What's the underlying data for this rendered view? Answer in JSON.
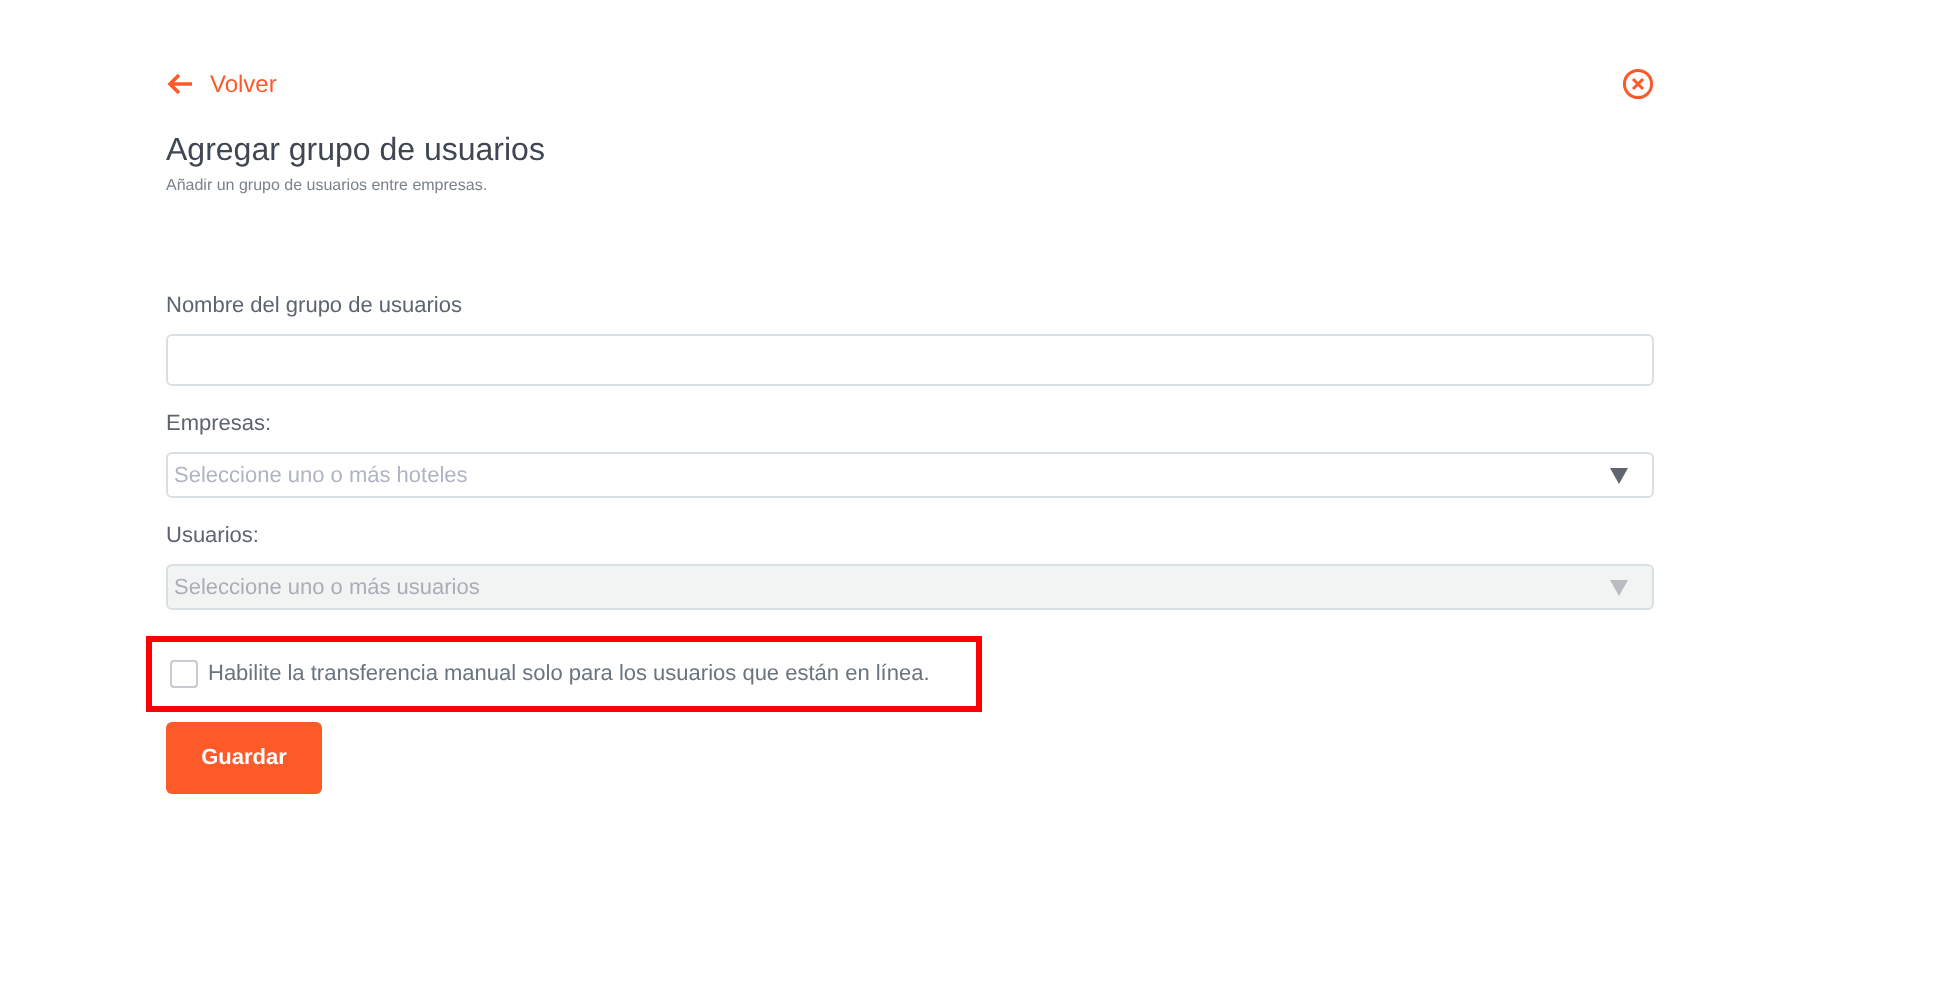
{
  "back_link": "Volver",
  "title": "Agregar grupo de usuarios",
  "subtitle": "Añadir un grupo de usuarios entre empresas.",
  "fields": [
    {
      "kind": "text",
      "label": "Nombre del grupo de usuarios"
    },
    {
      "kind": "select",
      "label": "Empresas:",
      "placeholder": "Seleccione uno o más hoteles",
      "disabled": false
    },
    {
      "kind": "select",
      "label": "Usuarios:",
      "placeholder": "Seleccione uno o más usuarios",
      "disabled": true
    }
  ],
  "checkbox": {
    "label": "Habilite la transferencia manual solo para los usuarios que están en línea.",
    "checked": false,
    "highlighted": true
  },
  "save_button": "Guardar"
}
